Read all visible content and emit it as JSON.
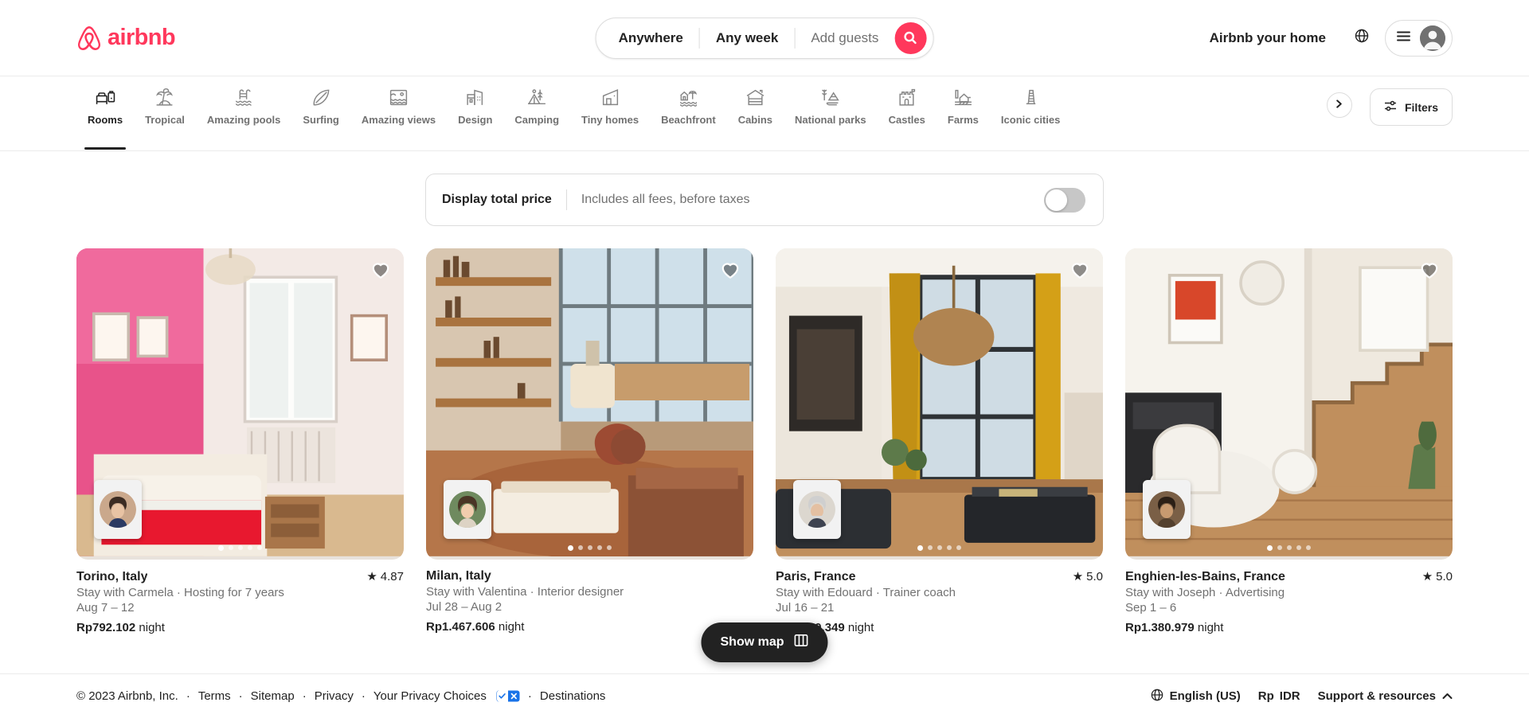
{
  "header": {
    "logo_text": "airbnb",
    "search": {
      "where": "Anywhere",
      "when": "Any week",
      "guests_placeholder": "Add guests",
      "search_icon": "search-icon"
    },
    "host_link": "Airbnb your home",
    "globe_icon": "globe-icon",
    "menu_icon": "hamburger-icon",
    "avatar_icon": "user-avatar-icon"
  },
  "categories": {
    "items": [
      {
        "label": "Rooms",
        "icon": "bed-room-icon",
        "active": true
      },
      {
        "label": "Tropical",
        "icon": "palm-tree-icon",
        "active": false
      },
      {
        "label": "Amazing pools",
        "icon": "pool-icon",
        "active": false
      },
      {
        "label": "Surfing",
        "icon": "surfboard-icon",
        "active": false
      },
      {
        "label": "Amazing views",
        "icon": "landscape-view-icon",
        "active": false
      },
      {
        "label": "Design",
        "icon": "design-building-icon",
        "active": false
      },
      {
        "label": "Camping",
        "icon": "tent-icon",
        "active": false
      },
      {
        "label": "Tiny homes",
        "icon": "tiny-home-icon",
        "active": false
      },
      {
        "label": "Beachfront",
        "icon": "beach-hut-icon",
        "active": false
      },
      {
        "label": "Cabins",
        "icon": "cabin-icon",
        "active": false
      },
      {
        "label": "National parks",
        "icon": "mountain-park-icon",
        "active": false
      },
      {
        "label": "Castles",
        "icon": "castle-icon",
        "active": false
      },
      {
        "label": "Farms",
        "icon": "farm-icon",
        "active": false
      },
      {
        "label": "Iconic cities",
        "icon": "tower-icon",
        "active": false
      }
    ],
    "next_icon": "chevron-right-icon",
    "filters_label": "Filters",
    "filters_icon": "filters-sliders-icon"
  },
  "total_price_bar": {
    "title": "Display total price",
    "subtitle": "Includes all fees, before taxes",
    "toggle_on": false
  },
  "listings": [
    {
      "title": "Torino, Italy",
      "rating": "4.87",
      "host": "Stay with Carmela · Hosting for 7 years",
      "dates": "Aug 7 – 12",
      "price": "Rp792.102",
      "price_unit": "night",
      "photos_count": 5,
      "active_photo": 1,
      "favorite": false
    },
    {
      "title": "Milan, Italy",
      "rating": "",
      "host": "Stay with Valentina · Interior designer",
      "dates": "Jul 28 – Aug 2",
      "price": "Rp1.467.606",
      "price_unit": "night",
      "photos_count": 5,
      "active_photo": 1,
      "favorite": false
    },
    {
      "title": "Paris, France",
      "rating": "5.0",
      "host": "Stay with Edouard · Trainer coach",
      "dates": "Jul 16 – 21",
      "price": "Rp1.440.349",
      "price_unit": "night",
      "photos_count": 5,
      "active_photo": 1,
      "favorite": false
    },
    {
      "title": "Enghien-les-Bains, France",
      "rating": "5.0",
      "host": "Stay with Joseph · Advertising",
      "dates": "Sep 1 – 6",
      "price": "Rp1.380.979",
      "price_unit": "night",
      "photos_count": 5,
      "active_photo": 1,
      "favorite": false
    }
  ],
  "show_map": {
    "label": "Show map",
    "icon": "map-icon"
  },
  "footer": {
    "copyright": "© 2023 Airbnb, Inc.",
    "links": [
      "Terms",
      "Sitemap",
      "Privacy",
      "Your Privacy Choices",
      "Destinations"
    ],
    "privacy_badge_icon": "privacy-choices-icon",
    "language": "English (US)",
    "currency_symbol": "Rp",
    "currency_code": "IDR",
    "support": "Support & resources",
    "support_caret_icon": "chevron-up-icon",
    "globe_icon": "globe-icon"
  },
  "colors": {
    "brand": "#FF385C",
    "text": "#222222",
    "muted": "#717171",
    "border": "#DDDDDD"
  }
}
